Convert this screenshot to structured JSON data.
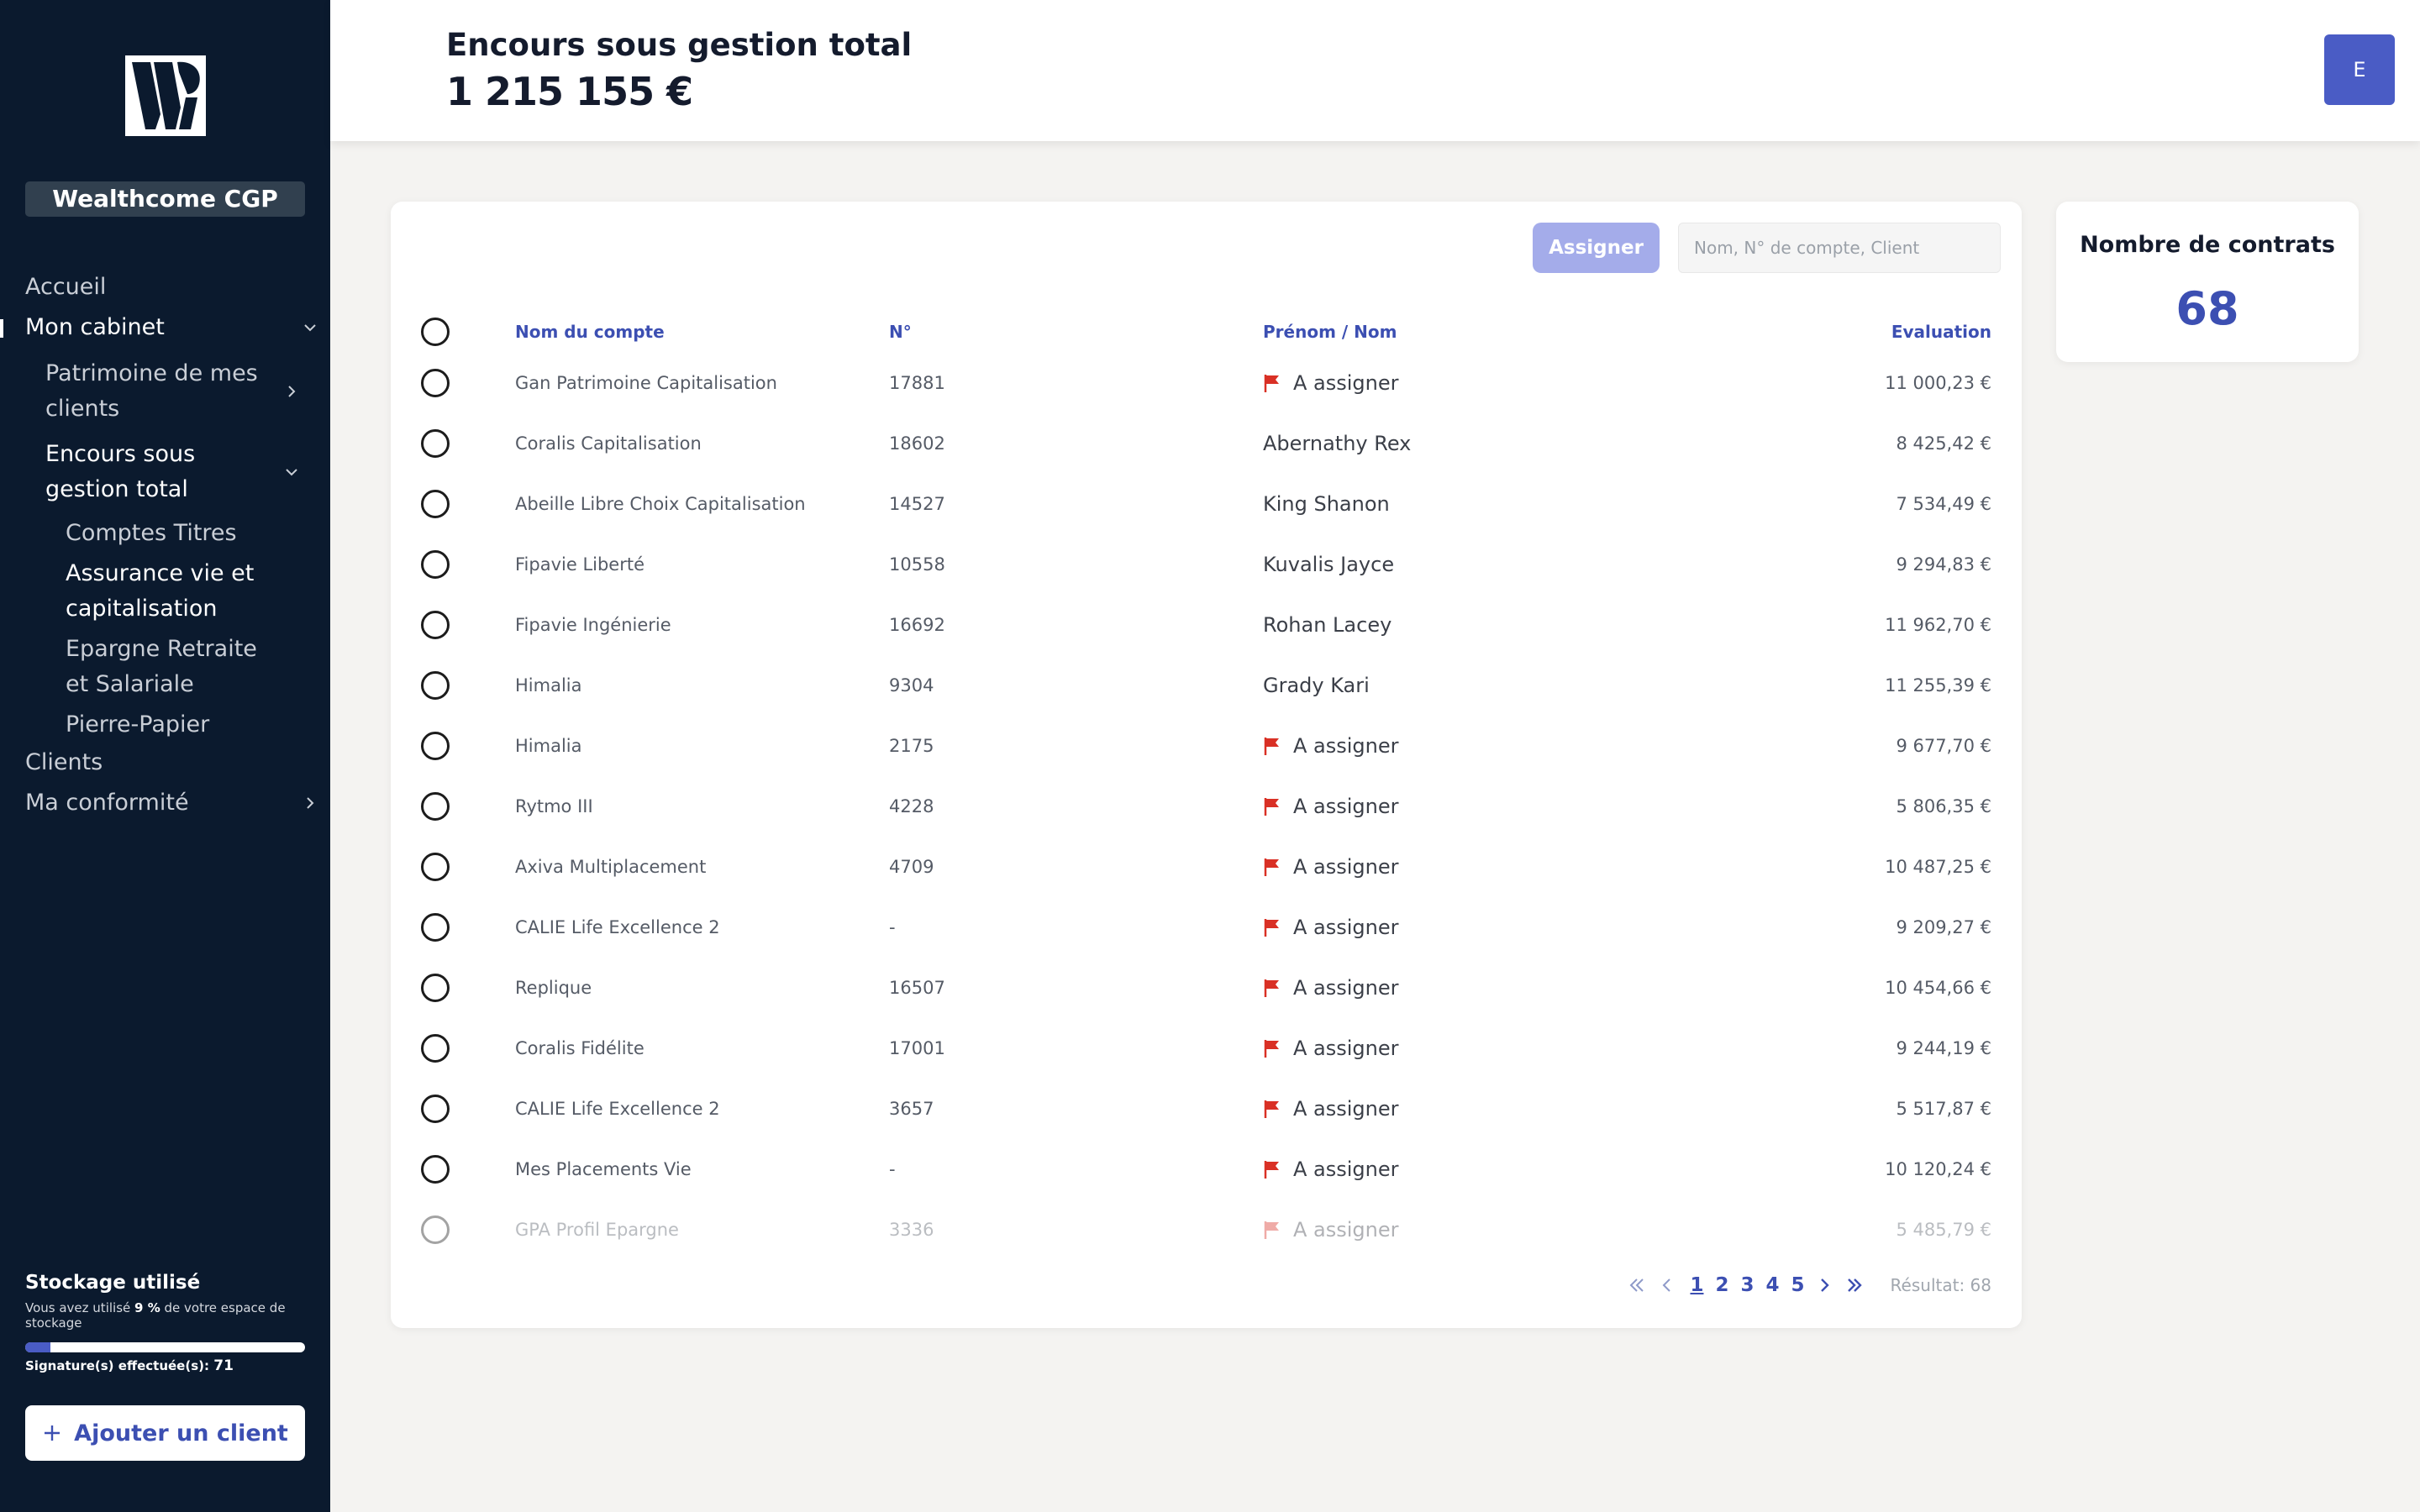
{
  "brand": {
    "name": "Wealthcome CGP"
  },
  "nav": {
    "accueil": "Accueil",
    "mon_cabinet": "Mon cabinet",
    "patrimoine": "Patrimoine de mes clients",
    "encours": "Encours sous gestion total",
    "comptes_titres": "Comptes Titres",
    "assurance_vie": "Assurance vie et capitalisation",
    "epargne": "Epargne Retraite et Salariale",
    "pierre_papier": "Pierre-Papier",
    "clients": "Clients",
    "conformite": "Ma conformité"
  },
  "storage": {
    "title": "Stockage utilisé",
    "note_prefix": "Vous avez utilisé",
    "percent_label": "9 %",
    "note_suffix": "de votre espace de stockage",
    "percent": 9,
    "signatures_label": "Signature(s) effectuée(s):",
    "signatures_value": "71"
  },
  "add_client": {
    "label": "Ajouter un client"
  },
  "header": {
    "title": "Encours sous gestion total",
    "total": "1 215 155 €",
    "avatar": "E"
  },
  "toolbar": {
    "assign_label": "Assigner",
    "search_placeholder": "Nom, N° de compte, Client"
  },
  "table": {
    "headers": {
      "name": "Nom du compte",
      "num": "N°",
      "person": "Prénom / Nom",
      "eval": "Evaluation"
    },
    "rows": [
      {
        "name": "Gan Patrimoine Capitalisation",
        "num": "17881",
        "person": "A assigner",
        "flag": true,
        "eval": "11 000,23 €"
      },
      {
        "name": "Coralis Capitalisation",
        "num": "18602",
        "person": "Abernathy Rex",
        "flag": false,
        "eval": "8 425,42 €"
      },
      {
        "name": "Abeille Libre Choix Capitalisation",
        "num": "14527",
        "person": "King Shanon",
        "flag": false,
        "eval": "7 534,49 €"
      },
      {
        "name": "Fipavie Liberté",
        "num": "10558",
        "person": "Kuvalis Jayce",
        "flag": false,
        "eval": "9 294,83 €"
      },
      {
        "name": "Fipavie Ingénierie",
        "num": "16692",
        "person": "Rohan Lacey",
        "flag": false,
        "eval": "11 962,70 €"
      },
      {
        "name": "Himalia",
        "num": "9304",
        "person": "Grady Kari",
        "flag": false,
        "eval": "11 255,39 €"
      },
      {
        "name": "Himalia",
        "num": "2175",
        "person": "A assigner",
        "flag": true,
        "eval": "9 677,70 €"
      },
      {
        "name": "Rytmo III",
        "num": "4228",
        "person": "A assigner",
        "flag": true,
        "eval": "5 806,35 €"
      },
      {
        "name": "Axiva Multiplacement",
        "num": "4709",
        "person": "A assigner",
        "flag": true,
        "eval": "10 487,25 €"
      },
      {
        "name": "CALIE Life Excellence 2",
        "num": "-",
        "person": "A assigner",
        "flag": true,
        "eval": "9 209,27 €"
      },
      {
        "name": "Replique",
        "num": "16507",
        "person": "A assigner",
        "flag": true,
        "eval": "10 454,66 €"
      },
      {
        "name": "Coralis Fidélite",
        "num": "17001",
        "person": "A assigner",
        "flag": true,
        "eval": "9 244,19 €"
      },
      {
        "name": "CALIE Life Excellence 2",
        "num": "3657",
        "person": "A assigner",
        "flag": true,
        "eval": "5 517,87 €"
      },
      {
        "name": "Mes Placements Vie",
        "num": "-",
        "person": "A assigner",
        "flag": true,
        "eval": "10 120,24 €"
      },
      {
        "name": "GPA Profil Epargne",
        "num": "3336",
        "person": "A assigner",
        "flag": true,
        "eval": "5 485,79 €"
      }
    ]
  },
  "pagination": {
    "pages": [
      "1",
      "2",
      "3",
      "4",
      "5"
    ],
    "current": "1",
    "result_label": "Résultat: 68"
  },
  "contracts": {
    "title": "Nombre de contrats",
    "value": "68"
  },
  "colors": {
    "sidebar": "#0b1a2e",
    "accent": "#3c4fb2",
    "avatar": "#4a5cc5",
    "assign_disabled": "#a4acea",
    "flag": "#d93025"
  }
}
